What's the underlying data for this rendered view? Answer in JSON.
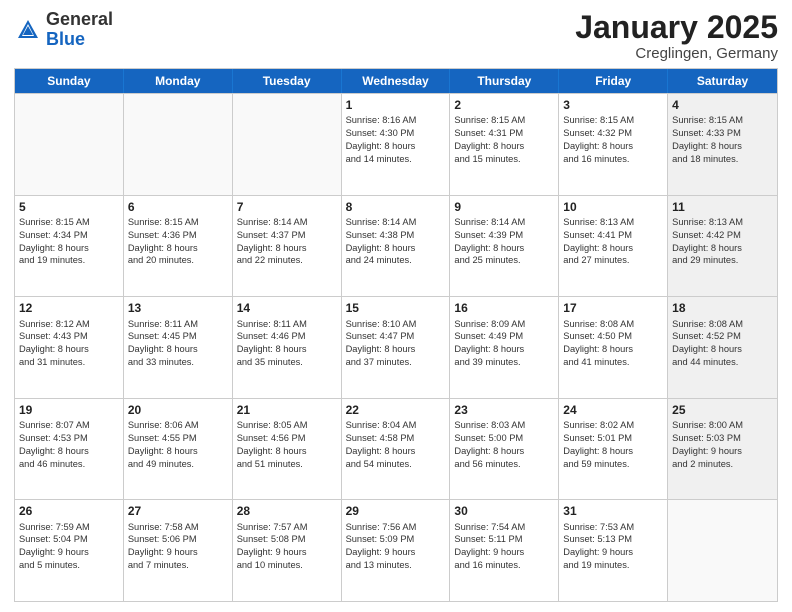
{
  "logo": {
    "general": "General",
    "blue": "Blue"
  },
  "header": {
    "title": "January 2025",
    "subtitle": "Creglingen, Germany"
  },
  "days": [
    "Sunday",
    "Monday",
    "Tuesday",
    "Wednesday",
    "Thursday",
    "Friday",
    "Saturday"
  ],
  "weeks": [
    [
      {
        "day": "",
        "content": "",
        "empty": true
      },
      {
        "day": "",
        "content": "",
        "empty": true
      },
      {
        "day": "",
        "content": "",
        "empty": true
      },
      {
        "day": "1",
        "content": "Sunrise: 8:16 AM\nSunset: 4:30 PM\nDaylight: 8 hours\nand 14 minutes."
      },
      {
        "day": "2",
        "content": "Sunrise: 8:15 AM\nSunset: 4:31 PM\nDaylight: 8 hours\nand 15 minutes."
      },
      {
        "day": "3",
        "content": "Sunrise: 8:15 AM\nSunset: 4:32 PM\nDaylight: 8 hours\nand 16 minutes."
      },
      {
        "day": "4",
        "content": "Sunrise: 8:15 AM\nSunset: 4:33 PM\nDaylight: 8 hours\nand 18 minutes.",
        "shaded": true
      }
    ],
    [
      {
        "day": "5",
        "content": "Sunrise: 8:15 AM\nSunset: 4:34 PM\nDaylight: 8 hours\nand 19 minutes."
      },
      {
        "day": "6",
        "content": "Sunrise: 8:15 AM\nSunset: 4:36 PM\nDaylight: 8 hours\nand 20 minutes."
      },
      {
        "day": "7",
        "content": "Sunrise: 8:14 AM\nSunset: 4:37 PM\nDaylight: 8 hours\nand 22 minutes."
      },
      {
        "day": "8",
        "content": "Sunrise: 8:14 AM\nSunset: 4:38 PM\nDaylight: 8 hours\nand 24 minutes."
      },
      {
        "day": "9",
        "content": "Sunrise: 8:14 AM\nSunset: 4:39 PM\nDaylight: 8 hours\nand 25 minutes."
      },
      {
        "day": "10",
        "content": "Sunrise: 8:13 AM\nSunset: 4:41 PM\nDaylight: 8 hours\nand 27 minutes."
      },
      {
        "day": "11",
        "content": "Sunrise: 8:13 AM\nSunset: 4:42 PM\nDaylight: 8 hours\nand 29 minutes.",
        "shaded": true
      }
    ],
    [
      {
        "day": "12",
        "content": "Sunrise: 8:12 AM\nSunset: 4:43 PM\nDaylight: 8 hours\nand 31 minutes."
      },
      {
        "day": "13",
        "content": "Sunrise: 8:11 AM\nSunset: 4:45 PM\nDaylight: 8 hours\nand 33 minutes."
      },
      {
        "day": "14",
        "content": "Sunrise: 8:11 AM\nSunset: 4:46 PM\nDaylight: 8 hours\nand 35 minutes."
      },
      {
        "day": "15",
        "content": "Sunrise: 8:10 AM\nSunset: 4:47 PM\nDaylight: 8 hours\nand 37 minutes."
      },
      {
        "day": "16",
        "content": "Sunrise: 8:09 AM\nSunset: 4:49 PM\nDaylight: 8 hours\nand 39 minutes."
      },
      {
        "day": "17",
        "content": "Sunrise: 8:08 AM\nSunset: 4:50 PM\nDaylight: 8 hours\nand 41 minutes."
      },
      {
        "day": "18",
        "content": "Sunrise: 8:08 AM\nSunset: 4:52 PM\nDaylight: 8 hours\nand 44 minutes.",
        "shaded": true
      }
    ],
    [
      {
        "day": "19",
        "content": "Sunrise: 8:07 AM\nSunset: 4:53 PM\nDaylight: 8 hours\nand 46 minutes."
      },
      {
        "day": "20",
        "content": "Sunrise: 8:06 AM\nSunset: 4:55 PM\nDaylight: 8 hours\nand 49 minutes."
      },
      {
        "day": "21",
        "content": "Sunrise: 8:05 AM\nSunset: 4:56 PM\nDaylight: 8 hours\nand 51 minutes."
      },
      {
        "day": "22",
        "content": "Sunrise: 8:04 AM\nSunset: 4:58 PM\nDaylight: 8 hours\nand 54 minutes."
      },
      {
        "day": "23",
        "content": "Sunrise: 8:03 AM\nSunset: 5:00 PM\nDaylight: 8 hours\nand 56 minutes."
      },
      {
        "day": "24",
        "content": "Sunrise: 8:02 AM\nSunset: 5:01 PM\nDaylight: 8 hours\nand 59 minutes."
      },
      {
        "day": "25",
        "content": "Sunrise: 8:00 AM\nSunset: 5:03 PM\nDaylight: 9 hours\nand 2 minutes.",
        "shaded": true
      }
    ],
    [
      {
        "day": "26",
        "content": "Sunrise: 7:59 AM\nSunset: 5:04 PM\nDaylight: 9 hours\nand 5 minutes."
      },
      {
        "day": "27",
        "content": "Sunrise: 7:58 AM\nSunset: 5:06 PM\nDaylight: 9 hours\nand 7 minutes."
      },
      {
        "day": "28",
        "content": "Sunrise: 7:57 AM\nSunset: 5:08 PM\nDaylight: 9 hours\nand 10 minutes."
      },
      {
        "day": "29",
        "content": "Sunrise: 7:56 AM\nSunset: 5:09 PM\nDaylight: 9 hours\nand 13 minutes."
      },
      {
        "day": "30",
        "content": "Sunrise: 7:54 AM\nSunset: 5:11 PM\nDaylight: 9 hours\nand 16 minutes."
      },
      {
        "day": "31",
        "content": "Sunrise: 7:53 AM\nSunset: 5:13 PM\nDaylight: 9 hours\nand 19 minutes."
      },
      {
        "day": "",
        "content": "",
        "empty": true,
        "shaded": true
      }
    ]
  ]
}
